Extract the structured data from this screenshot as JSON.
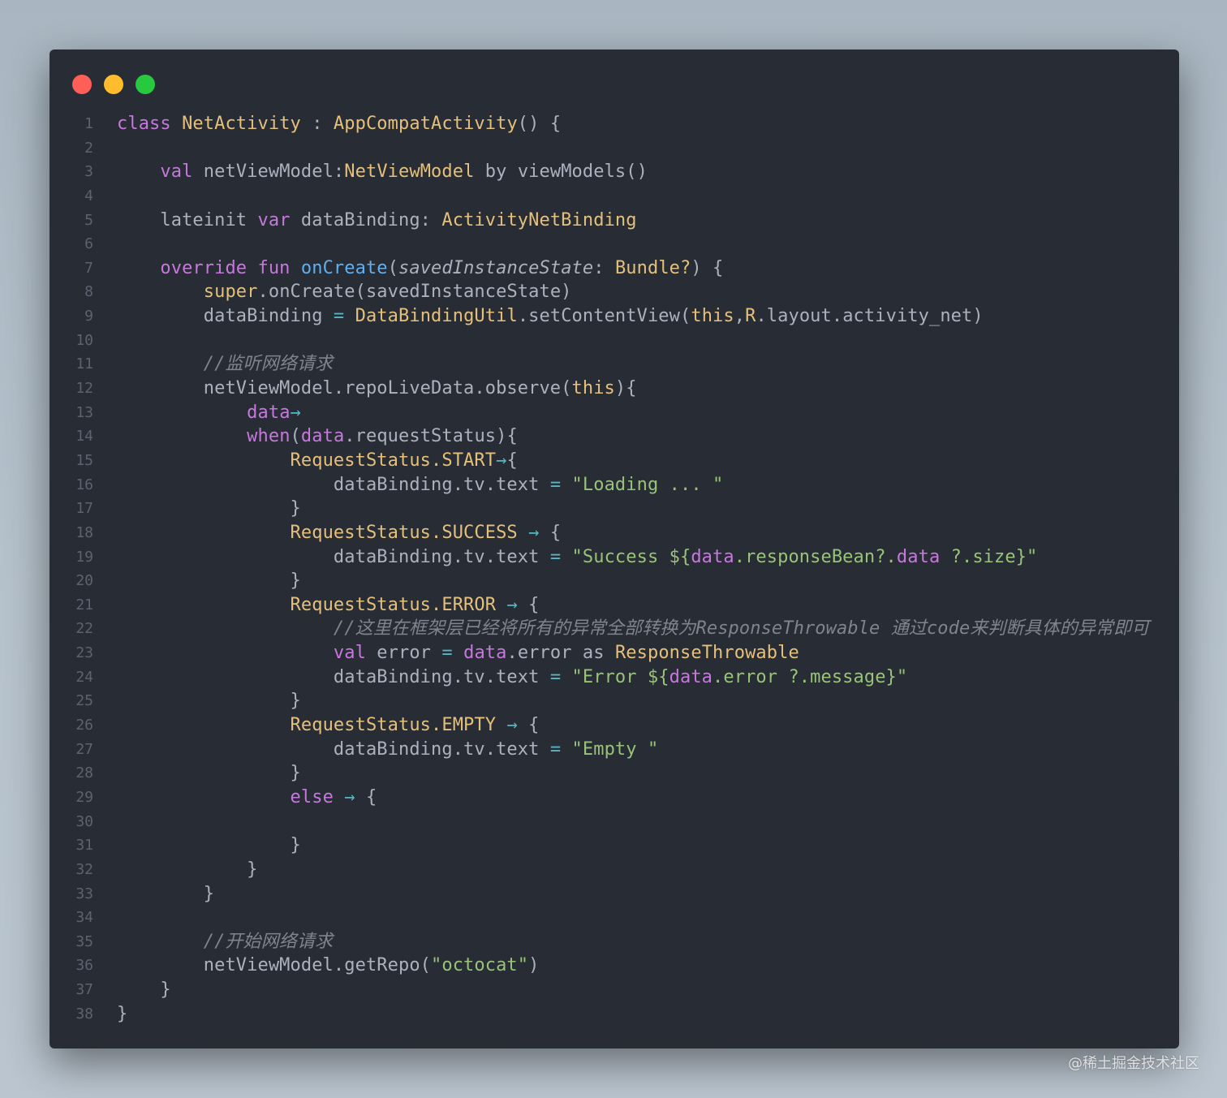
{
  "window": {
    "controls": [
      "close",
      "minimize",
      "maximize"
    ],
    "colors": {
      "close": "#ff5f56",
      "minimize": "#ffbd2e",
      "maximize": "#27c93f",
      "background": "#282c34"
    }
  },
  "watermark": "@稀土掘金技术社区",
  "code_lines": [
    {
      "n": "1",
      "tokens": [
        [
          "keyword",
          "class "
        ],
        [
          "type",
          "NetActivity"
        ],
        [
          "plain",
          " : "
        ],
        [
          "type",
          "AppCompatActivity"
        ],
        [
          "plain",
          "() {"
        ]
      ]
    },
    {
      "n": "2",
      "tokens": []
    },
    {
      "n": "3",
      "tokens": [
        [
          "plain",
          "    "
        ],
        [
          "keyword",
          "val "
        ],
        [
          "plain",
          "netViewModel:"
        ],
        [
          "type",
          "NetViewModel"
        ],
        [
          "plain",
          " by viewModels()"
        ]
      ]
    },
    {
      "n": "4",
      "tokens": []
    },
    {
      "n": "5",
      "tokens": [
        [
          "plain",
          "    lateinit "
        ],
        [
          "keyword",
          "var "
        ],
        [
          "plain",
          "dataBinding: "
        ],
        [
          "type",
          "ActivityNetBinding"
        ]
      ]
    },
    {
      "n": "6",
      "tokens": []
    },
    {
      "n": "7",
      "tokens": [
        [
          "plain",
          "    "
        ],
        [
          "keyword",
          "override fun "
        ],
        [
          "function",
          "onCreate"
        ],
        [
          "plain",
          "("
        ],
        [
          "param",
          "savedInstanceState"
        ],
        [
          "plain",
          ": "
        ],
        [
          "type",
          "Bundle?"
        ],
        [
          "plain",
          ") {"
        ]
      ]
    },
    {
      "n": "8",
      "tokens": [
        [
          "plain",
          "        "
        ],
        [
          "type",
          "super"
        ],
        [
          "plain",
          ".onCreate(savedInstanceState)"
        ]
      ]
    },
    {
      "n": "9",
      "tokens": [
        [
          "plain",
          "        dataBinding "
        ],
        [
          "operator",
          "="
        ],
        [
          "plain",
          " "
        ],
        [
          "type",
          "DataBindingUtil"
        ],
        [
          "plain",
          ".setContentView("
        ],
        [
          "type",
          "this"
        ],
        [
          "plain",
          ","
        ],
        [
          "type",
          "R"
        ],
        [
          "plain",
          ".layout.activity_net)"
        ]
      ]
    },
    {
      "n": "10",
      "tokens": []
    },
    {
      "n": "11",
      "tokens": [
        [
          "plain",
          "        "
        ],
        [
          "comment",
          "//监听网络请求"
        ]
      ]
    },
    {
      "n": "12",
      "tokens": [
        [
          "plain",
          "        netViewModel.repoLiveData.observe("
        ],
        [
          "type",
          "this"
        ],
        [
          "plain",
          "){"
        ]
      ]
    },
    {
      "n": "13",
      "tokens": [
        [
          "plain",
          "            "
        ],
        [
          "keyword",
          "data"
        ],
        [
          "operator",
          "→"
        ]
      ]
    },
    {
      "n": "14",
      "tokens": [
        [
          "plain",
          "            "
        ],
        [
          "keyword",
          "when"
        ],
        [
          "plain",
          "("
        ],
        [
          "keyword",
          "data"
        ],
        [
          "plain",
          ".requestStatus){"
        ]
      ]
    },
    {
      "n": "15",
      "tokens": [
        [
          "plain",
          "                "
        ],
        [
          "type",
          "RequestStatus.START"
        ],
        [
          "operator",
          "→"
        ],
        [
          "plain",
          "{"
        ]
      ]
    },
    {
      "n": "16",
      "tokens": [
        [
          "plain",
          "                    dataBinding.tv.text "
        ],
        [
          "operator",
          "="
        ],
        [
          "plain",
          " "
        ],
        [
          "string",
          "\"Loading ... \""
        ]
      ]
    },
    {
      "n": "17",
      "tokens": [
        [
          "plain",
          "                }"
        ]
      ]
    },
    {
      "n": "18",
      "tokens": [
        [
          "plain",
          "                "
        ],
        [
          "type",
          "RequestStatus.SUCCESS"
        ],
        [
          "plain",
          " "
        ],
        [
          "operator",
          "→"
        ],
        [
          "plain",
          " {"
        ]
      ]
    },
    {
      "n": "19",
      "tokens": [
        [
          "plain",
          "                    dataBinding.tv.text "
        ],
        [
          "operator",
          "="
        ],
        [
          "plain",
          " "
        ],
        [
          "string",
          "\"Success ${"
        ],
        [
          "keyword",
          "data"
        ],
        [
          "string",
          ".responseBean?."
        ],
        [
          "keyword",
          "data"
        ],
        [
          "string",
          " ?.size}\""
        ]
      ]
    },
    {
      "n": "20",
      "tokens": [
        [
          "plain",
          "                }"
        ]
      ]
    },
    {
      "n": "21",
      "tokens": [
        [
          "plain",
          "                "
        ],
        [
          "type",
          "RequestStatus.ERROR"
        ],
        [
          "plain",
          " "
        ],
        [
          "operator",
          "→"
        ],
        [
          "plain",
          " {"
        ]
      ]
    },
    {
      "n": "22",
      "tokens": [
        [
          "plain",
          "                    "
        ],
        [
          "comment",
          "//这里在框架层已经将所有的异常全部转换为ResponseThrowable 通过code来判断具体的异常即可"
        ]
      ]
    },
    {
      "n": "23",
      "tokens": [
        [
          "plain",
          "                    "
        ],
        [
          "keyword",
          "val "
        ],
        [
          "plain",
          "error "
        ],
        [
          "operator",
          "="
        ],
        [
          "plain",
          " "
        ],
        [
          "keyword",
          "data"
        ],
        [
          "plain",
          ".error as "
        ],
        [
          "type",
          "ResponseThrowable"
        ]
      ]
    },
    {
      "n": "24",
      "tokens": [
        [
          "plain",
          "                    dataBinding.tv.text "
        ],
        [
          "operator",
          "="
        ],
        [
          "plain",
          " "
        ],
        [
          "string",
          "\"Error ${"
        ],
        [
          "keyword",
          "data"
        ],
        [
          "string",
          ".error ?.message}\""
        ]
      ]
    },
    {
      "n": "25",
      "tokens": [
        [
          "plain",
          "                }"
        ]
      ]
    },
    {
      "n": "26",
      "tokens": [
        [
          "plain",
          "                "
        ],
        [
          "type",
          "RequestStatus.EMPTY"
        ],
        [
          "plain",
          " "
        ],
        [
          "operator",
          "→"
        ],
        [
          "plain",
          " {"
        ]
      ]
    },
    {
      "n": "27",
      "tokens": [
        [
          "plain",
          "                    dataBinding.tv.text "
        ],
        [
          "operator",
          "="
        ],
        [
          "plain",
          " "
        ],
        [
          "string",
          "\"Empty \""
        ]
      ]
    },
    {
      "n": "28",
      "tokens": [
        [
          "plain",
          "                }"
        ]
      ]
    },
    {
      "n": "29",
      "tokens": [
        [
          "plain",
          "                "
        ],
        [
          "keyword",
          "else"
        ],
        [
          "plain",
          " "
        ],
        [
          "operator",
          "→"
        ],
        [
          "plain",
          " {"
        ]
      ]
    },
    {
      "n": "30",
      "tokens": []
    },
    {
      "n": "31",
      "tokens": [
        [
          "plain",
          "                }"
        ]
      ]
    },
    {
      "n": "32",
      "tokens": [
        [
          "plain",
          "            }"
        ]
      ]
    },
    {
      "n": "33",
      "tokens": [
        [
          "plain",
          "        }"
        ]
      ]
    },
    {
      "n": "34",
      "tokens": []
    },
    {
      "n": "35",
      "tokens": [
        [
          "plain",
          "        "
        ],
        [
          "comment",
          "//开始网络请求"
        ]
      ]
    },
    {
      "n": "36",
      "tokens": [
        [
          "plain",
          "        netViewModel.getRepo("
        ],
        [
          "string",
          "\"octocat\""
        ],
        [
          "plain",
          ")"
        ]
      ]
    },
    {
      "n": "37",
      "tokens": [
        [
          "plain",
          "    }"
        ]
      ]
    },
    {
      "n": "38",
      "tokens": [
        [
          "plain",
          "}"
        ]
      ]
    }
  ]
}
